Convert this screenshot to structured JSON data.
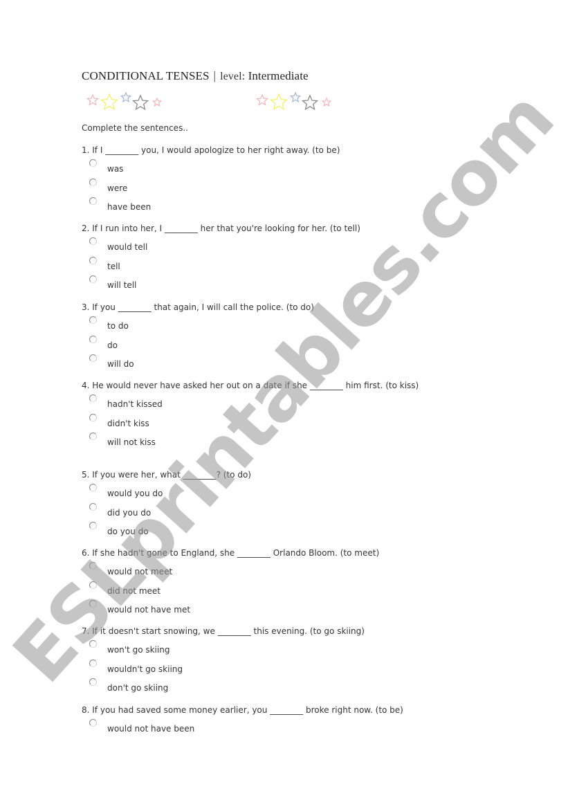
{
  "header": {
    "title": "CONDITIONAL TENSES",
    "separator": "|",
    "level_label": "level:",
    "level_value": "Intermediate"
  },
  "decoration": {
    "stars_icon": "stars-decoration",
    "star_colors": [
      "#f2b8c0",
      "#f5ef6a",
      "#a9b8dc",
      "#8a8a8a",
      "#f2b8c0"
    ]
  },
  "instructions": "Complete the sentences..",
  "questions": [
    {
      "text": "1. If I ________ you, I would apologize to her right away. (to be)",
      "options": [
        "was",
        "were",
        "have been"
      ]
    },
    {
      "text": "2. If I run into her, I ________ her that you're looking for her. (to tell)",
      "options": [
        "would tell",
        "tell",
        "will tell"
      ]
    },
    {
      "text": "3. If you ________ that again, I will call the police. (to do)",
      "options": [
        "to do",
        "do",
        "will do"
      ]
    },
    {
      "text": "4. He would never have asked her out on a date if she ________ him first. (to kiss)",
      "options": [
        "hadn't kissed",
        "didn't kiss",
        "will not kiss"
      ]
    },
    {
      "text": "5. If you were her, what ________? (to do)",
      "options": [
        "would you do",
        "did you do",
        "do you do"
      ]
    },
    {
      "text": "6. If she hadn't gone to England, she ________ Orlando Bloom. (to meet)",
      "options": [
        "would not meet",
        "did not meet",
        "would not have met"
      ]
    },
    {
      "text": "7. If it doesn't start snowing, we ________ this evening. (to go skiing)",
      "options": [
        "won't go skiing",
        "wouldn't go skiing",
        "don't go skiing"
      ]
    },
    {
      "text": "8. If you had saved some money earlier, you ________ broke right now. (to be)",
      "options": [
        "would not have been"
      ]
    }
  ],
  "watermark": "ESLprintables.com"
}
